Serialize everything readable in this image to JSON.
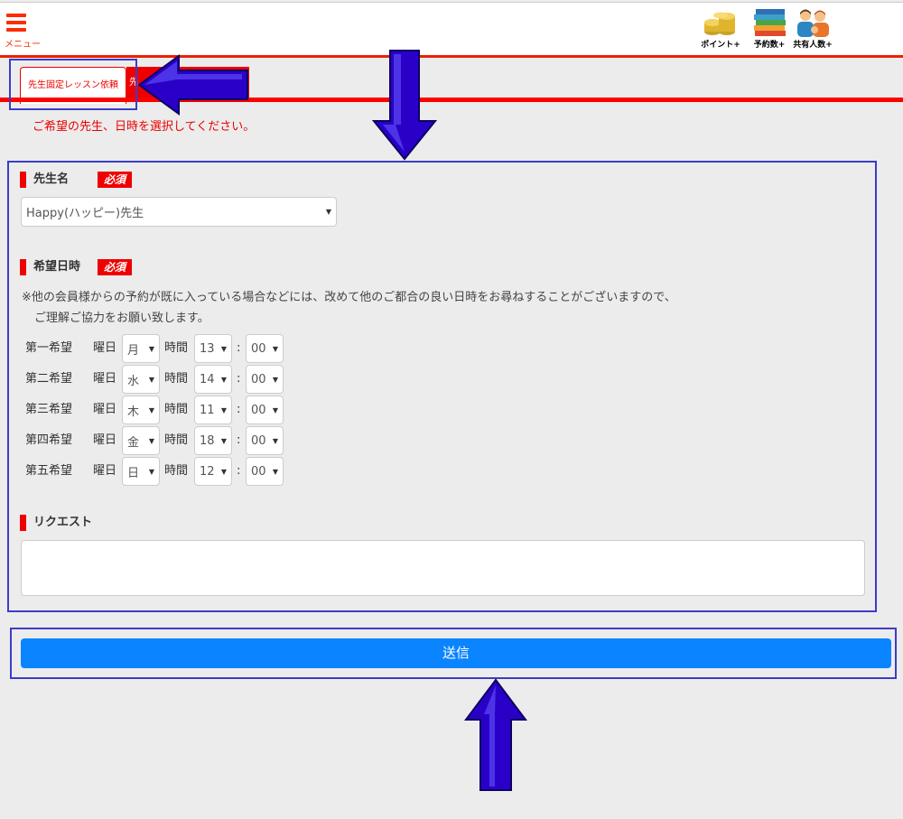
{
  "header": {
    "menu_label": "メニュー",
    "icons": [
      {
        "name": "coins-icon",
        "label": "ポイント+"
      },
      {
        "name": "books-icon",
        "label": "予約数+"
      },
      {
        "name": "people-icon",
        "label": "共有人数+"
      }
    ]
  },
  "tabs": {
    "active_label": "先生固定レッスン依頼",
    "second_label": "先"
  },
  "instruction": "ご希望の先生、日時を選択してください。",
  "form": {
    "required_badge": "必須",
    "teacher": {
      "label": "先生名",
      "selected": "Happy(ハッピー)先生"
    },
    "datetime": {
      "label": "希望日時",
      "note_line1": "※他の会員様からの予約が既に入っている場合などには、改めて他のご都合の良い日時をお尋ねすることがございますので、",
      "note_line2": "ご理解ご協力をお願い致します。",
      "day_label": "曜日",
      "time_label": "時間",
      "colon": ":",
      "preferences": [
        {
          "label": "第一希望",
          "day": "月",
          "hour": "13",
          "minute": "00"
        },
        {
          "label": "第二希望",
          "day": "水",
          "hour": "14",
          "minute": "00"
        },
        {
          "label": "第三希望",
          "day": "木",
          "hour": "11",
          "minute": "00"
        },
        {
          "label": "第四希望",
          "day": "金",
          "hour": "18",
          "minute": "00"
        },
        {
          "label": "第五希望",
          "day": "日",
          "hour": "12",
          "minute": "00"
        }
      ]
    },
    "request": {
      "label": "リクエスト",
      "value": ""
    },
    "submit_label": "送信"
  },
  "colors": {
    "accent": "#ff0000",
    "button": "#0a84ff",
    "annotation": "#2a00c8"
  }
}
